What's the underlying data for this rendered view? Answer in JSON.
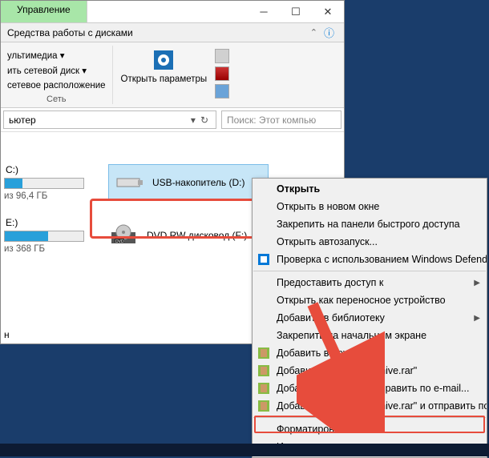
{
  "titlebar": {
    "active_tab": "Управление"
  },
  "ribbonbar": {
    "label": "Средства работы с дисками"
  },
  "ribbon": {
    "network": {
      "items": [
        "ультимедиа ▾",
        "ить сетевой диск ▾",
        "сетевое расположение"
      ],
      "group_label": "Сеть"
    },
    "params": {
      "label": "Открыть параметры"
    }
  },
  "addressbar": {
    "path": "ьютер",
    "search_placeholder": "Поиск: Этот компью"
  },
  "drives": {
    "c": {
      "label": "C:)",
      "free": "из 96,4 ГБ",
      "fill_pct": 22
    },
    "e": {
      "label": "E:)",
      "free": "из 368 ГБ",
      "fill_pct": 55
    },
    "usb": {
      "label": "USB-накопитель (D:)"
    },
    "dvd": {
      "label": "DVD RW дисковод (F:)"
    }
  },
  "content_footer": "н",
  "context_menu": {
    "open": "Открыть",
    "open_new": "Открыть в новом окне",
    "pin_quick": "Закрепить на панели быстрого доступа",
    "autoplay": "Открыть автозапуск...",
    "defender": "Проверка с использованием Windows Defender...",
    "share": "Предоставить доступ к",
    "portable": "Открыть как переносное устройство",
    "library": "Добавить в библиотеку",
    "pin_start": "Закрепить на начальном экране",
    "archive": "Добавить в архив...",
    "archive_rar": "Добавить в архив \"Archive.rar\"",
    "archive_email": "Добавить в архив и отправить по e-mail...",
    "archive_rar_email": "Добавить в архив \"Archive.rar\" и отправить по e-mail",
    "format": "Форматировать...",
    "eject": "Извлечь"
  }
}
